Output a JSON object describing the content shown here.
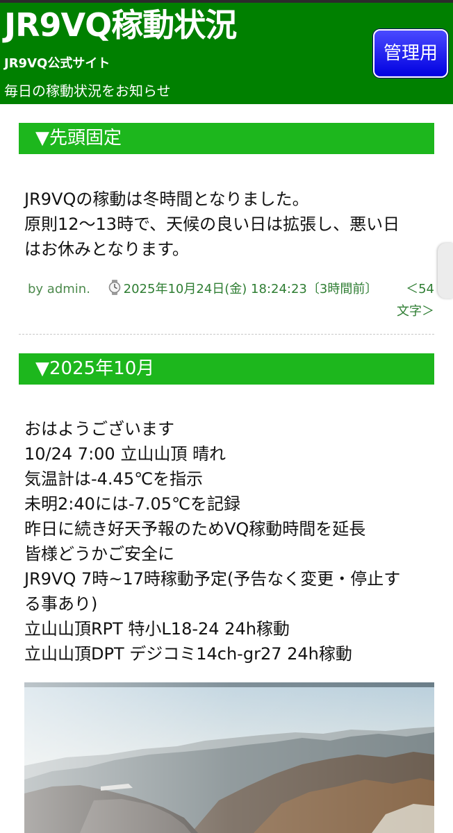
{
  "header": {
    "title": "JR9VQ稼動状況",
    "subtitle": "JR9VQ公式サイト",
    "description": "毎日の稼動状況をお知らせ",
    "admin_button": "管理用",
    "background_color": "#008000"
  },
  "sections": {
    "pinned": {
      "heading": "▼先頭固定",
      "body_lines": [
        "JR9VQの稼動は冬時間となりました。",
        "原則12～13時で、天候の良い日は拡張し、悪い日",
        "はお休みとなります。"
      ],
      "author": "by admin.",
      "posted": "2025年10月24日(金) 18:24:23〔3時間前〕",
      "char_count_line1": "＜54",
      "char_count_line2": "文字＞"
    },
    "october": {
      "heading": "▼2025年10月",
      "body_lines": [
        "おはようございます",
        "10/24 7:00 立山山頂 晴れ",
        "気温計は-4.45℃を指示",
        "未明2:40には-7.05℃を記録",
        "昨日に続き好天予報のためVQ稼動時間を延長",
        "皆様どうかご安全に",
        "JR9VQ 7時~17時稼動予定(予告なく変更・停止す",
        "る事あり)",
        "立山山頂RPT 特小L18-24 24h稼動",
        "立山山頂DPT デジコミ14ch-gr27 24h稼動"
      ]
    }
  },
  "colors": {
    "section_bar": "#1db71d",
    "meta_text": "#2e7d32",
    "admin_button": "#0000e0"
  },
  "icons": {
    "watch": "watch-icon"
  }
}
